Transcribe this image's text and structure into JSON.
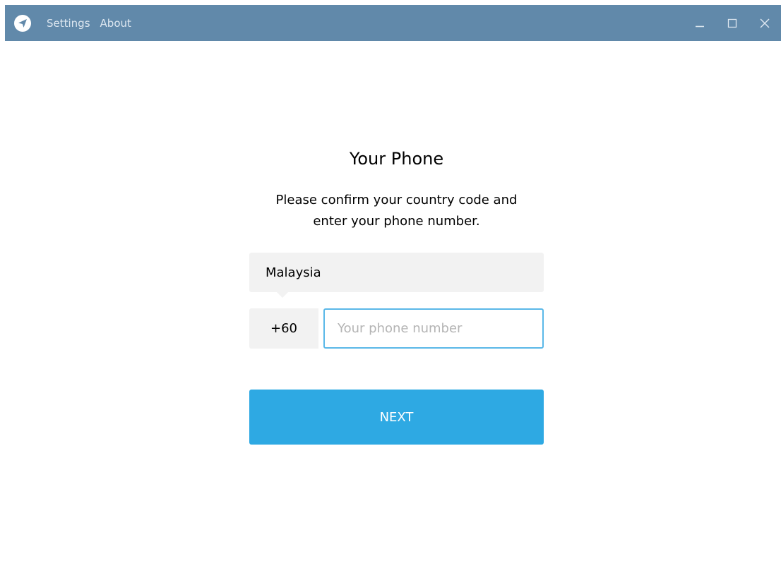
{
  "titlebar": {
    "logo_icon": "telegram-plane-icon",
    "menu": [
      {
        "label": "Settings"
      },
      {
        "label": "About"
      }
    ],
    "controls": {
      "minimize_icon": "minimize-icon",
      "maximize_icon": "maximize-icon",
      "close_icon": "close-icon"
    },
    "background_color": "#6189aa"
  },
  "login": {
    "title": "Your Phone",
    "description": "Please confirm your country code and\nenter your phone number.",
    "country": "Malaysia",
    "country_code": "+60",
    "phone_value": "",
    "phone_placeholder": "Your phone number",
    "next_label": "NEXT",
    "accent_color": "#2ea9e3"
  }
}
